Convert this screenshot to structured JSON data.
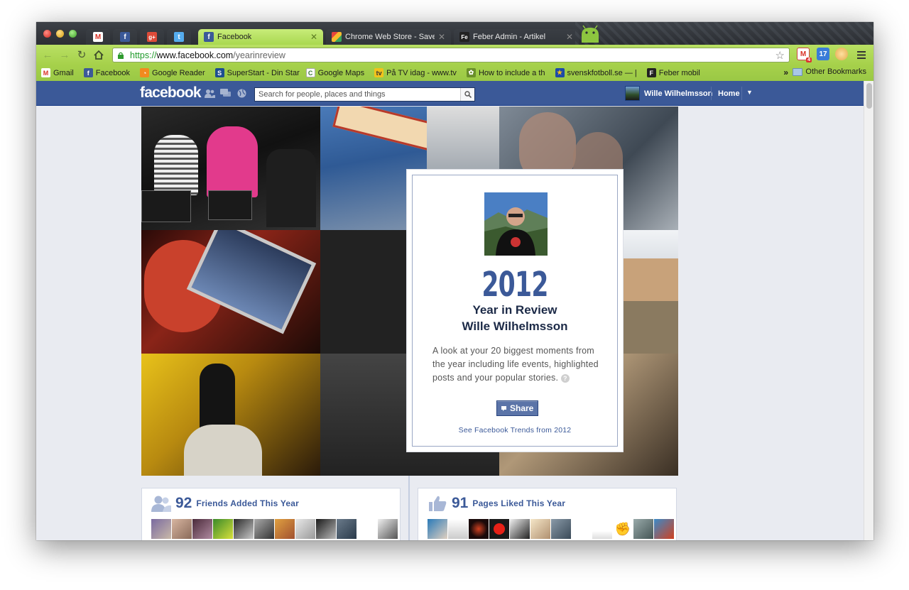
{
  "browser": {
    "pinned_tabs": [
      {
        "icon": "gmail-icon",
        "color": "#d93025"
      },
      {
        "icon": "facebook-icon",
        "color": "#3b5998"
      },
      {
        "icon": "google-plus-icon",
        "color": "#dd4b39"
      },
      {
        "icon": "twitter-icon",
        "color": "#55acee"
      }
    ],
    "tabs": [
      {
        "title": "Facebook",
        "active": true
      },
      {
        "title": "Chrome Web Store - Save to",
        "active": false
      },
      {
        "title": "Feber Admin - Artikel",
        "active": false
      }
    ],
    "url": {
      "scheme": "https://",
      "host": "www.facebook.com",
      "path": "/yearinreview"
    },
    "extensions": {
      "gmail_badge": "4",
      "calendar_badge": "17"
    },
    "bookmarks": [
      {
        "label": "Gmail",
        "icon": "gmail-icon"
      },
      {
        "label": "Facebook",
        "icon": "facebook-icon"
      },
      {
        "label": "Google Reader",
        "icon": "rss-icon"
      },
      {
        "label": "SuperStart - Din Star",
        "icon": "superstart-icon"
      },
      {
        "label": "Google Maps",
        "icon": "maps-icon"
      },
      {
        "label": "På TV idag - www.tv",
        "icon": "tv-icon"
      },
      {
        "label": "How to include a th",
        "icon": "leaf-icon"
      },
      {
        "label": "svenskfotboll.se — |",
        "icon": "football-icon"
      },
      {
        "label": "Feber mobil",
        "icon": "feber-icon"
      }
    ],
    "bookmarks_more": "»",
    "other_bookmarks": "Other Bookmarks"
  },
  "fb": {
    "logo": "facebook",
    "search_placeholder": "Search for people, places and things",
    "user_name": "Wille Wilhelmsson",
    "home": "Home",
    "card": {
      "year": "2012",
      "title_line1": "Year in Review",
      "title_line2": "Wille Wilhelmsson",
      "description": "A look at your 20 biggest moments from the year including life events, highlighted posts and your popular stories.",
      "share": "Share",
      "trends_link": "See Facebook Trends from 2012"
    },
    "friends": {
      "count": "92",
      "label": "Friends Added This Year"
    },
    "pages": {
      "count": "91",
      "label": "Pages Liked This Year"
    }
  },
  "colors": {
    "fb_blue": "#3b5998",
    "chrome_green": "#a6d14b"
  }
}
